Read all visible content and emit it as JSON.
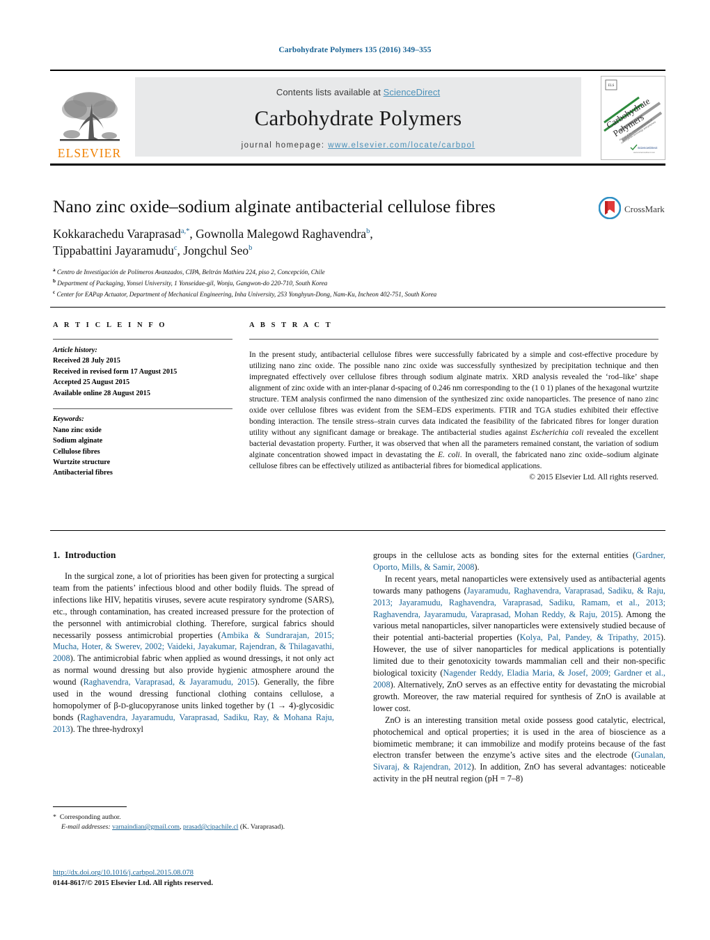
{
  "running_head": "Carbohydrate Polymers 135 (2016) 349–355",
  "masthead": {
    "contents_prefix": "Contents lists available at ",
    "contents_link": "ScienceDirect",
    "journal_title": "Carbohydrate Polymers",
    "homepage_prefix": "journal homepage: ",
    "homepage_url": "www.elsevier.com/locate/carbpol",
    "publisher_logo_text": "ELSEVIER",
    "cover_title_line1": "Carbohydrate",
    "cover_title_line2": "Polymers",
    "link_color": "#4a90b8",
    "logo_color": "#f08000"
  },
  "crossmark": {
    "label": "CrossMark"
  },
  "article": {
    "title": "Nano zinc oxide–sodium alginate antibacterial cellulose fibres",
    "authors_line1": "Kokkarachedu Varaprasad",
    "authors_line1_sup": "a,*",
    "authors_line1b": ", Gownolla Malegowd Raghavendra",
    "authors_line1b_sup": "b",
    "authors_line2": "Tippabattini Jayaramudu",
    "authors_line2_sup": "c",
    "authors_line2b": ", Jongchul Seo",
    "authors_line2b_sup": "b",
    "affiliations": [
      {
        "marker": "a",
        "text": "Centro de Investigación de Polímeros Avanzados, CIPA, Beltrán Mathieu 224, piso 2, Concepción, Chile"
      },
      {
        "marker": "b",
        "text": "Department of Packaging, Yonsei University, 1 Yonseidae-gil, Wonju, Gangwon-do 220-710, South Korea"
      },
      {
        "marker": "c",
        "text": "Center for EAPap Actuator, Department of Mechanical Engineering, Inha University, 253 Yonghyun-Dong, Nam-Ku, Incheon 402-751, South Korea"
      }
    ]
  },
  "article_info": {
    "heading": "A R T I C L E   I N F O",
    "history_label": "Article history:",
    "history": [
      "Received 28 July 2015",
      "Received in revised form 17 August 2015",
      "Accepted 25 August 2015",
      "Available online 28 August 2015"
    ],
    "keywords_label": "Keywords:",
    "keywords": [
      "Nano zinc oxide",
      "Sodium alginate",
      "Cellulose fibres",
      "Wurtzite structure",
      "Antibacterial fibres"
    ]
  },
  "abstract": {
    "heading": "A B S T R A C T",
    "part1": "In the present study, antibacterial cellulose fibres were successfully fabricated by a simple and cost-effective procedure by utilizing nano zinc oxide. The possible nano zinc oxide was successfully synthesized by precipitation technique and then impregnated effectively over cellulose fibres through sodium alginate matrix. XRD analysis revealed the ‘rod–like’ shape alignment of zinc oxide with an inter-planar d-spacing of 0.246 nm corresponding to the (1 0 1) planes of the hexagonal wurtzite structure. TEM analysis confirmed the nano dimension of the synthesized zinc oxide nanoparticles. The presence of nano zinc oxide over cellulose fibres was evident from the SEM–EDS experiments. FTIR and TGA studies exhibited their effective bonding interaction. The tensile stress–strain curves data indicated the feasibility of the fabricated fibres for longer duration utility without any significant damage or breakage. The antibacterial studies against ",
    "italic1": "Escherichia coli",
    "part2": " revealed the excellent bacterial devastation property. Further, it was observed that when all the parameters remained constant, the variation of sodium alginate concentration showed impact in devastating the ",
    "italic2": "E. coli",
    "part3": ". In overall, the fabricated nano zinc oxide–sodium alginate cellulose fibres can be effectively utilized as antibacterial fibres for biomedical applications.",
    "copyright": "© 2015 Elsevier Ltd. All rights reserved."
  },
  "introduction": {
    "number": "1.",
    "heading": "Introduction",
    "left_p1_a": "In the surgical zone, a lot of priorities has been given for protecting a surgical team from the patients’ infectious blood and other bodily fluids. The spread of infections like HIV, hepatitis viruses, severe acute respiratory syndrome (SARS), etc., through contamination, has created increased pressure for the protection of the personnel with antimicrobial clothing. Therefore, surgical fabrics should necessarily possess antimicrobial properties (",
    "left_cite1": "Ambika & Sundrarajan, 2015; Mucha, Hoter, & Swerev, 2002; Vaideki, Jayakumar, Rajendran, & Thilagavathi, 2008",
    "left_p1_b": "). The antimicrobial fabric when applied as wound dressings, it not only act as normal wound dressing but also provide hygienic atmosphere around the wound (",
    "left_cite2": "Raghavendra, Varaprasad, & Jayaramudu, 2015",
    "left_p1_c": "). Generally, the fibre used in the wound dressing functional clothing contains cellulose, a homopolymer of β-",
    "left_smallcaps": "D",
    "left_p1_d": "-glucopyranose units linked together by (1 → 4)-glycosidic bonds (",
    "left_cite3": "Raghavendra, Jayaramudu, Varaprasad, Sadiku, Ray, & Mohana Raju, 2013",
    "left_p1_e": "). The three-hydroxyl",
    "right_p1_a": "groups in the cellulose acts as bonding sites for the external entities (",
    "right_cite1": "Gardner, Oporto, Mills, & Samir, 2008",
    "right_p1_b": ").",
    "right_p2_a": "In recent years, metal nanoparticles were extensively used as antibacterial agents towards many pathogens (",
    "right_cite2": "Jayaramudu, Raghavendra, Varaprasad, Sadiku, & Raju, 2013; Jayaramudu, Raghavendra, Varaprasad, Sadiku, Ramam, et al., 2013; Raghavendra, Jayaramudu, Varaprasad, Mohan Reddy, & Raju, 2015",
    "right_p2_b": "). Among the various metal nanoparticles, silver nanoparticles were extensively studied because of their potential anti-bacterial properties (",
    "right_cite3": "Kolya, Pal, Pandey, & Tripathy, 2015",
    "right_p2_c": "). However, the use of silver nanoparticles for medical applications is potentially limited due to their genotoxicity towards mammalian cell and their non-specific biological toxicity (",
    "right_cite4": "Nagender Reddy, Eladia Maria, & Josef, 2009; Gardner et al., 2008",
    "right_p2_d": "). Alternatively, ZnO serves as an effective entity for devastating the microbial growth. Moreover, the raw material required for synthesis of ZnO is available at lower cost.",
    "right_p3_a": "ZnO is an interesting transition metal oxide possess good catalytic, electrical, photochemical and optical properties; it is used in the area of bioscience as a biomimetic membrane; it can immobilize and modify proteins because of the fast electron transfer between the enzyme’s active sites and the electrode (",
    "right_cite5": "Gunalan, Sivaraj, & Rajendran, 2012",
    "right_p3_b": "). In addition, ZnO has several advantages: noticeable activity in the pH neutral region (pH = 7–8)"
  },
  "footnote": {
    "star": "*",
    "corresponding": "Corresponding author.",
    "email_label": "E-mail addresses:",
    "email1": "varnaindian@gmail.com",
    "email_sep": ", ",
    "email2": "prasad@cipachile.cl",
    "email_suffix": " (K. Varaprasad)."
  },
  "footer": {
    "doi": "http://dx.doi.org/10.1016/j.carbpol.2015.08.078",
    "issn_line": "0144-8617/© 2015 Elsevier Ltd. All rights reserved."
  }
}
